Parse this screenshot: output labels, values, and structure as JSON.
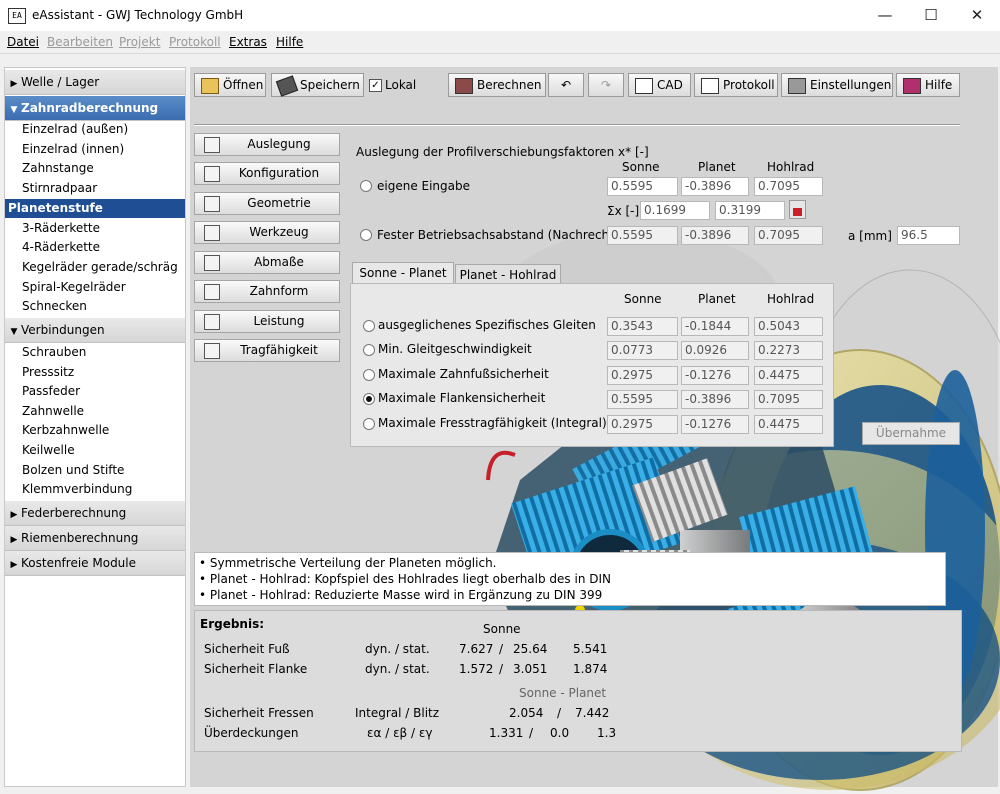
{
  "window": {
    "icon_text": "EA",
    "title": "eAssistant - GWJ Technology GmbH",
    "minimize": "—",
    "maximize": "☐",
    "close": "✕"
  },
  "menu": {
    "datei": "Datei",
    "bearbeiten": "Bearbeiten",
    "projekt": "Projekt",
    "protokoll": "Protokoll",
    "extras": "Extras",
    "hilfe": "Hilfe"
  },
  "sidebar": {
    "welle": "Welle / Lager",
    "zahnrad": "Zahnradberechnung",
    "zahnrad_items": [
      "Einzelrad (außen)",
      "Einzelrad (innen)",
      "Zahnstange",
      "Stirnradpaar",
      "Planetenstufe",
      "3-Räderkette",
      "4-Räderkette",
      "Kegelräder gerade/schräg",
      "Spiral-Kegelräder",
      "Schnecken"
    ],
    "verbindungen": "Verbindungen",
    "verbindungen_items": [
      "Schrauben",
      "Presssitz",
      "Passfeder",
      "Zahnwelle",
      "Kerbzahnwelle",
      "Keilwelle",
      "Bolzen und Stifte",
      "Klemmverbindung"
    ],
    "feder": "Federberechnung",
    "riemen": "Riemenberechnung",
    "kostenfrei": "Kostenfreie Module"
  },
  "toolbar": {
    "oeffnen": "Öffnen",
    "speichern": "Speichern",
    "lokal": "Lokal",
    "berechnen": "Berechnen",
    "undo": "↶",
    "redo": "↷",
    "cad": "CAD",
    "protokoll": "Protokoll",
    "einstellungen": "Einstellungen",
    "hilfe": "Hilfe"
  },
  "nav": [
    "Auslegung",
    "Konfiguration",
    "Geometrie",
    "Werkzeug",
    "Abmaße",
    "Zahnform",
    "Leistung",
    "Tragfähigkeit"
  ],
  "profil": {
    "heading": "Auslegung der Profilverschiebungsfaktoren x* [-]",
    "col_sonne": "Sonne",
    "col_planet": "Planet",
    "col_hohlrad": "Hohlrad",
    "eigene": "eigene Eingabe",
    "eigene_vals": [
      "0.5595",
      "-0.3896",
      "0.7095"
    ],
    "sigma_label": "Σx [-]",
    "sigma_vals": [
      "0.1699",
      "0.3199"
    ],
    "fester": "Fester Betriebsachsabstand (Nachrech...",
    "fester_vals": [
      "0.5595",
      "-0.3896",
      "0.7095"
    ],
    "a_label": "a [mm]",
    "a_val": "96.5"
  },
  "tabs": {
    "sonne_planet": "Sonne - Planet",
    "planet_hohlrad": "Planet - Hohlrad"
  },
  "tabpanel": {
    "col_sonne": "Sonne",
    "col_planet": "Planet",
    "col_hohlrad": "Hohlrad",
    "rows": [
      {
        "label": "ausgeglichenes Spezifisches Gleiten",
        "vals": [
          "0.3543",
          "-0.1844",
          "0.5043"
        ]
      },
      {
        "label": "Min. Gleitgeschwindigkeit",
        "vals": [
          "0.0773",
          "0.0926",
          "0.2273"
        ]
      },
      {
        "label": "Maximale Zahnfußsicherheit",
        "vals": [
          "0.2975",
          "-0.1276",
          "0.4475"
        ]
      },
      {
        "label": "Maximale Flankensicherheit",
        "vals": [
          "0.5595",
          "-0.3896",
          "0.7095"
        ]
      },
      {
        "label": "Maximale Fresstragfähigkeit (Integral)",
        "vals": [
          "0.2975",
          "-0.1276",
          "0.4475"
        ]
      }
    ],
    "selected_row": 3,
    "uebernahme": "Übernahme"
  },
  "notes": [
    "• Symmetrische Verteilung der Planeten möglich.",
    "• Planet - Hohlrad: Kopfspiel des Hohlrades liegt oberhalb des in DIN",
    "• Planet - Hohlrad: Reduzierte Masse wird in Ergänzung zu DIN 399"
  ],
  "results": {
    "heading": "Ergebnis:",
    "col_sonne": "Sonne",
    "col_sonne_planet": "Sonne - Planet",
    "fuss": {
      "label": "Sicherheit Fuß",
      "type": "dyn. / stat.",
      "v1": "7.627",
      "sep": "/",
      "v2": "25.64",
      "v3": "5.541"
    },
    "flanke": {
      "label": "Sicherheit Flanke",
      "type": "dyn. / stat.",
      "v1": "1.572",
      "sep": "/",
      "v2": "3.051",
      "v3": "1.874"
    },
    "fressen": {
      "label": "Sicherheit Fressen",
      "type": "Integral / Blitz",
      "v1": "2.054",
      "sep": "/",
      "v2": "7.442"
    },
    "ueberdeckungen": {
      "label": "Überdeckungen",
      "type": "εα / εβ / εγ",
      "v1": "1.331",
      "sep": "/",
      "v2": "0.0",
      "v3": "1.3"
    }
  },
  "colors": {
    "accent_blue": "#1f4e94",
    "section_active": "#3a6cb0",
    "gear_blue": "#1e9bd7",
    "housing_yellow": "#d8c96a",
    "housing_navy": "#0e4c86"
  }
}
